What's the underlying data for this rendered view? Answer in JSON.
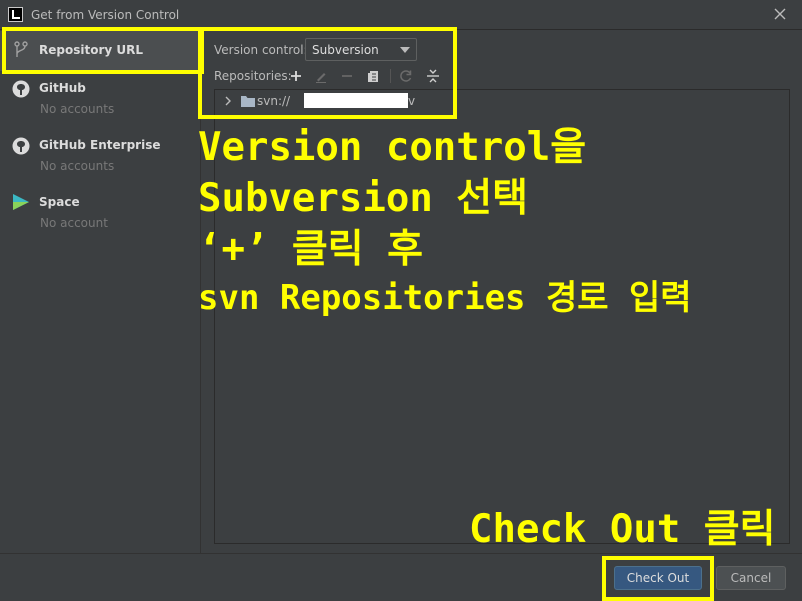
{
  "window": {
    "title": "Get from Version Control",
    "close_icon": "close-icon"
  },
  "colors": {
    "background": "#3c3f41",
    "selected": "#4b4e50",
    "accent_button": "#365880",
    "annotation": "#ffff00"
  },
  "sidebar": {
    "items": [
      {
        "label": "Repository URL",
        "sub": "",
        "icon": "vcs-branch-icon"
      },
      {
        "label": "GitHub",
        "sub": "No accounts",
        "icon": "github-icon"
      },
      {
        "label": "GitHub Enterprise",
        "sub": "No accounts",
        "icon": "github-icon"
      },
      {
        "label": "Space",
        "sub": "No account",
        "icon": "space-icon"
      }
    ]
  },
  "main": {
    "vc_label": "Version control:",
    "vc_selected": "Subversion",
    "repo_label": "Repositories:",
    "toolbar": [
      "add-icon",
      "edit-icon",
      "remove-icon",
      "copy-icon",
      "refresh-icon",
      "collapse-icon"
    ],
    "tree": {
      "prefix": "svn://",
      "suffix": "v"
    }
  },
  "footer": {
    "checkout_label": "Check Out",
    "cancel_label": "Cancel"
  },
  "annotations": {
    "lines": [
      "Version control을",
      "Subversion 선택",
      "‘+’ 클릭 후",
      "svn Repositories 경로 입력"
    ],
    "checkout_note": "Check Out 클릭"
  }
}
